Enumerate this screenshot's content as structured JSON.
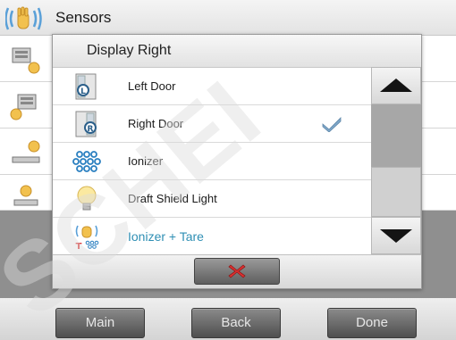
{
  "screen": {
    "title": "Sensors"
  },
  "dialog": {
    "title": "Display Right",
    "items": [
      {
        "label": "Left Door",
        "icon": "left-door-icon",
        "checked": false,
        "accent": false
      },
      {
        "label": "Right Door",
        "icon": "right-door-icon",
        "checked": true,
        "accent": false
      },
      {
        "label": "Ionizer",
        "icon": "ionizer-icon",
        "checked": false,
        "accent": false
      },
      {
        "label": "Draft Shield Light",
        "icon": "light-bulb-icon",
        "checked": false,
        "accent": false
      },
      {
        "label": "Ionizer + Tare",
        "icon": "ionizer-tare-icon",
        "checked": false,
        "accent": true
      }
    ],
    "cancel_icon": "close-icon"
  },
  "bottom_bar": {
    "main_label": "Main",
    "back_label": "Back",
    "done_label": "Done"
  },
  "watermark": "SCHEI",
  "colors": {
    "accent_text": "#2f8fb4",
    "cancel_x": "#e03030",
    "check": "#7ea6c8"
  }
}
